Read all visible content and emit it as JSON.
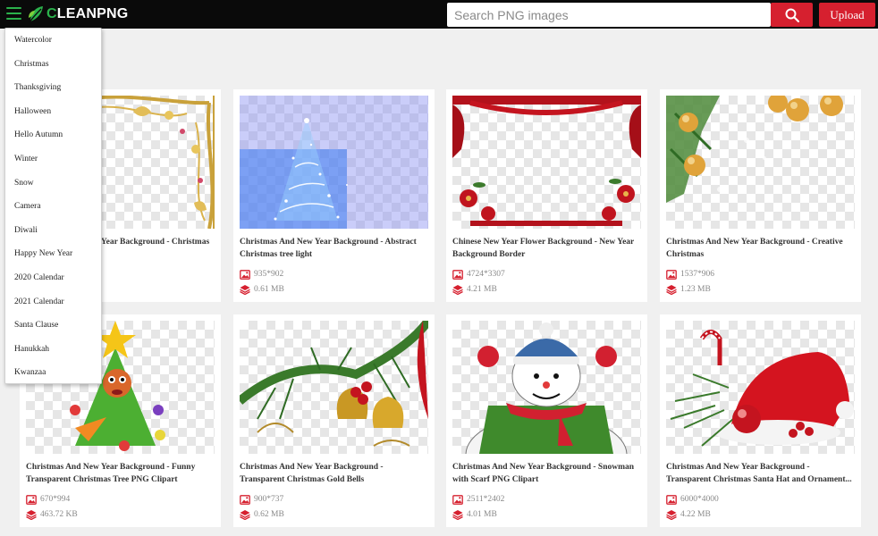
{
  "brand": {
    "name_prefix": "C",
    "name_rest": "LEANPNG"
  },
  "search": {
    "placeholder": "Search PNG images",
    "value": "",
    "upload_label": "Upload"
  },
  "menu": {
    "items": [
      "Watercolor",
      "Christmas",
      "Thanksgiving",
      "Halloween",
      "Hello Autumn",
      "Winter",
      "Snow",
      "Camera",
      "Diwali",
      "Happy New Year",
      "2020 Calendar",
      "2021 Calendar",
      "Santa Clause",
      "Hanukkah",
      "Kwanzaa"
    ]
  },
  "cards": [
    {
      "title": "Christmas And New Year Background - Christmas Background image",
      "dimensions": "",
      "size": "",
      "art": "gold-corner"
    },
    {
      "title": "Christmas And New Year Background - Abstract Christmas tree light",
      "dimensions": "935*902",
      "size": "0.61 MB",
      "art": "blue-tree"
    },
    {
      "title": "Chinese New Year Flower Background - New Year Background Border",
      "dimensions": "4724*3307",
      "size": "4.21 MB",
      "art": "red-frame"
    },
    {
      "title": "Christmas And New Year Background - Creative Christmas",
      "dimensions": "1537*906",
      "size": "1.23 MB",
      "art": "ornaments"
    },
    {
      "title": "Christmas And New Year Background - Funny Transparent Christmas Tree PNG Clipart",
      "dimensions": "670*994",
      "size": "463.72 KB",
      "art": "funny-tree"
    },
    {
      "title": "Christmas And New Year Background - Transparent Christmas Gold Bells",
      "dimensions": "900*737",
      "size": "0.62 MB",
      "art": "gold-bells"
    },
    {
      "title": "Christmas And New Year Background - Snowman with Scarf PNG Clipart",
      "dimensions": "2511*2402",
      "size": "4.01 MB",
      "art": "snowman"
    },
    {
      "title": "Christmas And New Year Background - Transparent Christmas Santa Hat and Ornament...",
      "dimensions": "6000*4000",
      "size": "4.22 MB",
      "art": "santa-hat"
    }
  ],
  "icons": {
    "menu": "hamburger-menu-icon",
    "logo": "leaf-logo-icon",
    "search": "search-icon",
    "dimensions": "image-icon",
    "size": "layers-icon"
  },
  "colors": {
    "brand_green": "#2bb24c",
    "accent_red": "#d6202f",
    "topbar": "#0a0a0a",
    "page_bg": "#f0f0f0"
  }
}
